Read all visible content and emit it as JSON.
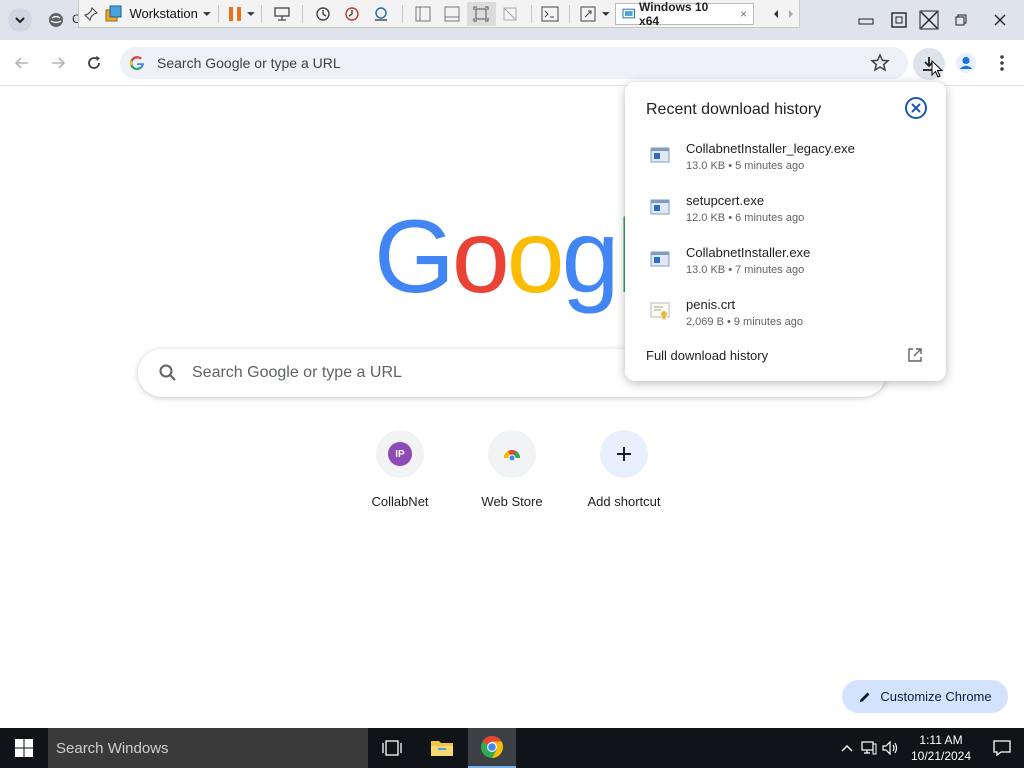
{
  "browser": {
    "tab_peek_text": "C",
    "vmware": {
      "vm_name_label": "Workstation",
      "vm_tab_label": "Windows 10 x64",
      "vm_tab_close": "×"
    },
    "omnibox": {
      "placeholder": "Search Google or type a URL"
    }
  },
  "ntp": {
    "search_placeholder": "Search Google or type a URL",
    "shortcuts": [
      {
        "label": "CollabNet",
        "badge": "IP"
      },
      {
        "label": "Web Store"
      },
      {
        "label": "Add shortcut"
      }
    ],
    "customize_label": "Customize Chrome"
  },
  "downloads": {
    "title": "Recent download history",
    "items": [
      {
        "name": "CollabnetInstaller_legacy.exe",
        "meta": "13.0 KB • 5 minutes ago",
        "icon": "exe-file-icon"
      },
      {
        "name": "setupcert.exe",
        "meta": "12.0 KB • 6 minutes ago",
        "icon": "exe-file-icon"
      },
      {
        "name": "CollabnetInstaller.exe",
        "meta": "13.0 KB • 7 minutes ago",
        "icon": "exe-file-icon"
      },
      {
        "name": "penis.crt",
        "meta": "2,069 B • 9 minutes ago",
        "icon": "certificate-file-icon"
      }
    ],
    "footer_label": "Full download history"
  },
  "taskbar": {
    "search_placeholder": "Search Windows",
    "time": "1:11 AM",
    "date": "10/21/2024"
  },
  "colors": {
    "accent_blue": "#1a73e8",
    "titlebar": "#dfe3eb",
    "taskbar": "#101418"
  }
}
